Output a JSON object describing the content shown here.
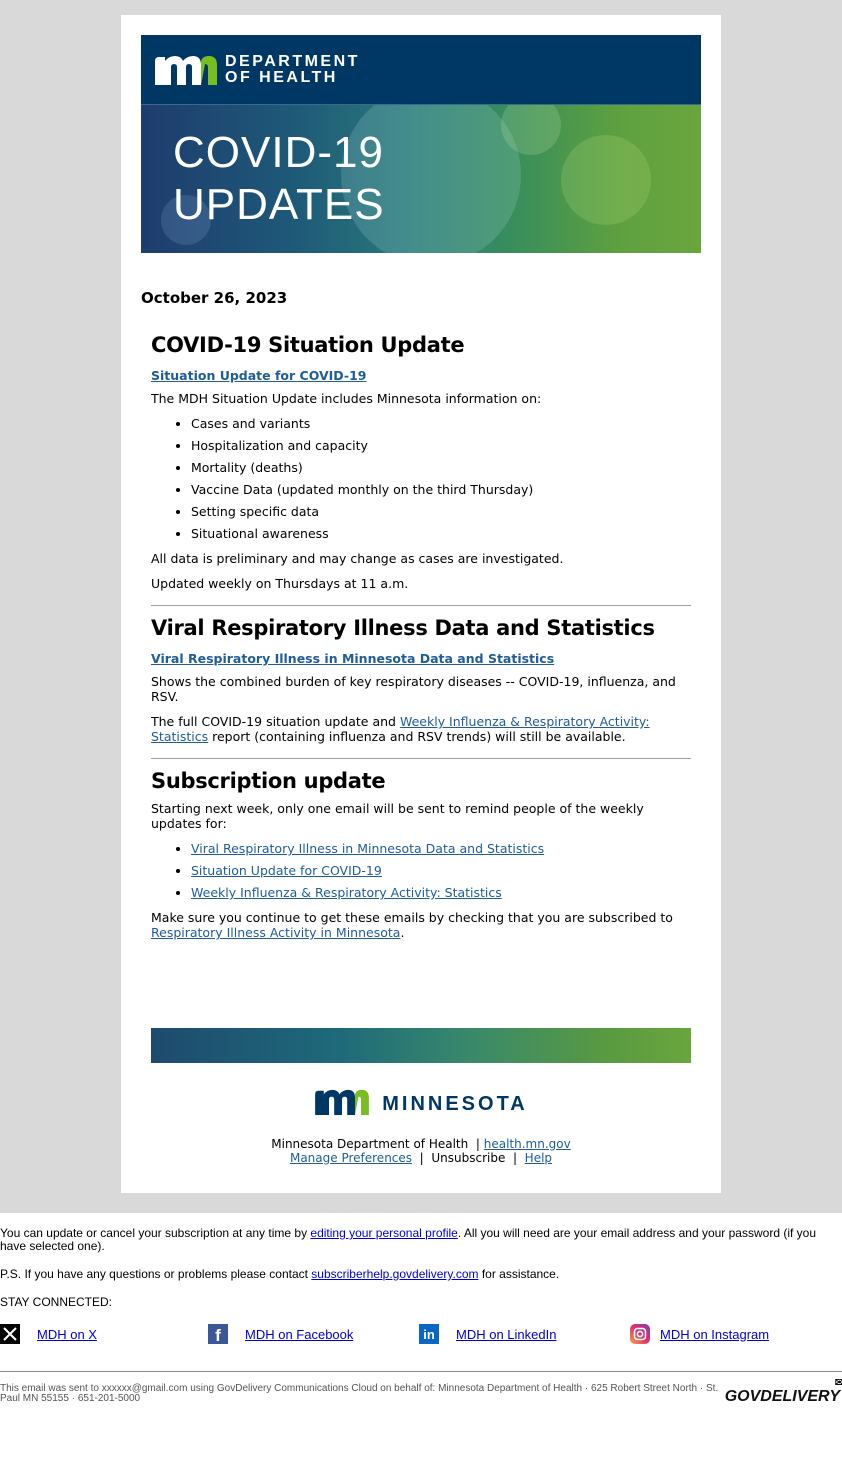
{
  "header": {
    "logo_text_line1": "DEPARTMENT",
    "logo_text_line2": "OF HEALTH",
    "hero_line1": "COVID-19",
    "hero_line2": "UPDATES",
    "colors": {
      "navy": "#003865",
      "green": "#78be20"
    }
  },
  "date": "October 26, 2023",
  "sections": [
    {
      "title": "COVID-19 Situation Update",
      "link": "Situation Update for COVID-19",
      "intro": "The MDH Situation Update includes Minnesota information on:",
      "items": [
        "Cases and variants",
        "Hospitalization and capacity",
        "Mortality (deaths)",
        "Vaccine Data (updated monthly on the third Thursday)",
        "Setting specific data",
        "Situational awareness"
      ],
      "note1": "All data is preliminary and may change as cases are investigated.",
      "note2": "Updated weekly on Thursdays at 11 a.m."
    },
    {
      "title": "Viral Respiratory Illness Data and Statistics",
      "link": "Viral Respiratory Illness in Minnesota Data and Statistics",
      "desc": "Shows the combined burden of key respiratory diseases -- COVID-19, influenza, and RSV.",
      "full_pre": "The full COVID-19 situation update and ",
      "full_link": "Weekly Influenza & Respiratory Activity: Statistics",
      "full_post": " report (containing influenza and RSV trends) will still be available."
    },
    {
      "title": "Subscription update",
      "intro": "Starting next week, only one email will be sent to remind people of the weekly updates for:",
      "links": [
        "Viral Respiratory Illness in Minnesota Data and Statistics",
        "Situation Update for COVID-19",
        "Weekly Influenza & Respiratory Activity: Statistics"
      ],
      "closing_pre": "Make sure you continue to get these emails by checking that you are subscribed to ",
      "closing_link": "Respiratory Illness Activity in Minnesota",
      "closing_post": "."
    }
  ],
  "footer": {
    "brand_word": "MINNESOTA",
    "org": "Minnesota Department of Health",
    "site_link": "health.mn.gov",
    "manage": "Manage Preferences",
    "unsubscribe": "Unsubscribe",
    "help": "Help",
    "sep": "|"
  },
  "outer": {
    "update_pre": "You can update or cancel your subscription at any time by ",
    "update_link": "editing your personal profile",
    "update_post": ". All you will need are your email address and your password (if you have selected one).",
    "ps_pre": "P.S. If you have any questions or problems please contact ",
    "ps_link": "subscriberhelp.govdelivery.com",
    "ps_post": " for assistance.",
    "stay_connected": "STAY CONNECTED:",
    "social": [
      {
        "icon": "x-icon",
        "label": "MDH on X"
      },
      {
        "icon": "facebook-icon",
        "label": "MDH on Facebook"
      },
      {
        "icon": "linkedin-icon",
        "label": "MDH on LinkedIn"
      },
      {
        "icon": "instagram-icon",
        "label": "MDH on Instagram"
      }
    ],
    "legal": "This email was sent to xxxxxx@gmail.com using GovDelivery Communications Cloud on behalf of: Minnesota Department of Health · 625 Robert Street North · St. Paul MN 55155 · 651-201-5000",
    "govdelivery_logo": "GOVDELIVERY"
  }
}
